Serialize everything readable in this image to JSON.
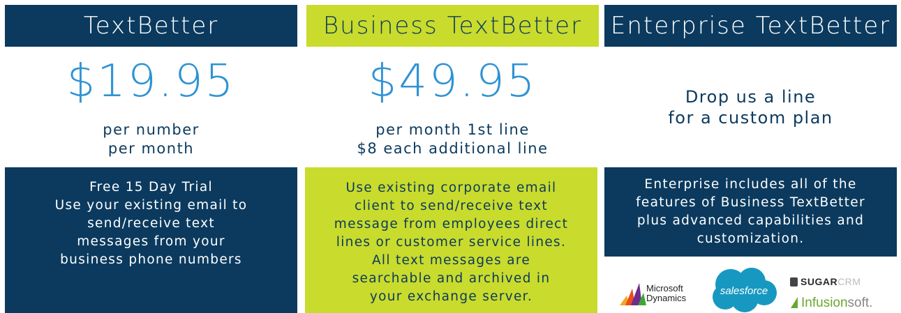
{
  "plans": [
    {
      "title": "TextBetter",
      "price": "$19.95",
      "sub1": "per number",
      "sub2": "per month",
      "desc": [
        "Free 15 Day Trial",
        "Use your existing email to",
        "send/receive text",
        "messages from your",
        "business phone numbers"
      ]
    },
    {
      "title": "Business TextBetter",
      "price": "$49.95",
      "sub1": "per month 1st line",
      "sub2": "$8 each additional line",
      "desc": [
        "Use existing corporate email",
        "client to send/receive text",
        "message from employees direct",
        "lines or customer service lines.",
        "All text messages are",
        "searchable and archived in",
        "your exchange server."
      ]
    },
    {
      "title": "Enterprise TextBetter",
      "sub1": "Drop us a line",
      "sub2": "for a custom plan",
      "desc": [
        "Enterprise includes all of the",
        "features of Business TextBetter",
        "plus advanced capabilities and",
        "customization."
      ]
    }
  ],
  "logos": {
    "microsoft_1": "Microsoft",
    "microsoft_2": "Dynamics",
    "salesforce": "salesforce",
    "sugar_bold": "SUGAR",
    "sugar_light": "CRM",
    "infusion_1": "Infusion",
    "infusion_2": "soft."
  },
  "colors": {
    "navy": "#0b3a5e",
    "lime": "#c9db2c",
    "price_blue": "#2f93d3"
  }
}
